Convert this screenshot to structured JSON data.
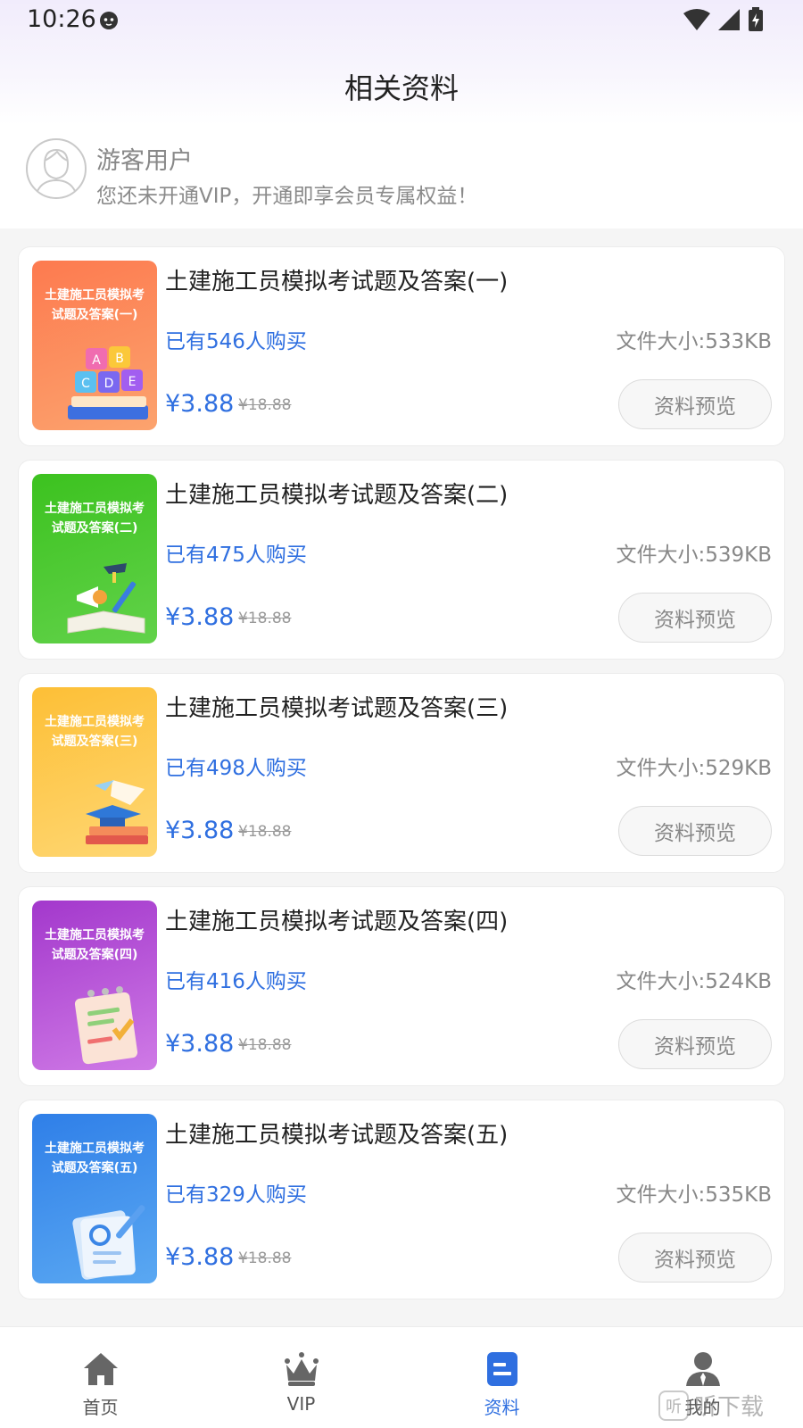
{
  "status_bar": {
    "time": "10:26"
  },
  "header": {
    "title": "相关资料"
  },
  "user": {
    "name": "游客用户",
    "tip": "您还未开通VIP，开通即享会员专属权益！"
  },
  "materials": [
    {
      "cover_line1": "土建施工员模拟考",
      "cover_line2": "试题及答案(一)",
      "title": "土建施工员模拟考试题及答案(一)",
      "buyers": "已有546人购买",
      "file_size": "文件大小:533KB",
      "price": "¥3.88",
      "original_price": "¥18.88",
      "preview_label": "资料预览",
      "cover_color": "#fb8a5a"
    },
    {
      "cover_line1": "土建施工员模拟考",
      "cover_line2": "试题及答案(二)",
      "title": "土建施工员模拟考试题及答案(二)",
      "buyers": "已有475人购买",
      "file_size": "文件大小:539KB",
      "price": "¥3.88",
      "original_price": "¥18.88",
      "preview_label": "资料预览",
      "cover_color": "#49c12c"
    },
    {
      "cover_line1": "土建施工员模拟考",
      "cover_line2": "试题及答案(三)",
      "title": "土建施工员模拟考试题及答案(三)",
      "buyers": "已有498人购买",
      "file_size": "文件大小:529KB",
      "price": "¥3.88",
      "original_price": "¥18.88",
      "preview_label": "资料预览",
      "cover_color": "#fdc94a"
    },
    {
      "cover_line1": "土建施工员模拟考",
      "cover_line2": "试题及答案(四)",
      "title": "土建施工员模拟考试题及答案(四)",
      "buyers": "已有416人购买",
      "file_size": "文件大小:524KB",
      "price": "¥3.88",
      "original_price": "¥18.88",
      "preview_label": "资料预览",
      "cover_color": "#b44fd6"
    },
    {
      "cover_line1": "土建施工员模拟考",
      "cover_line2": "试题及答案(五)",
      "title": "土建施工员模拟考试题及答案(五)",
      "buyers": "已有329人购买",
      "file_size": "文件大小:535KB",
      "price": "¥3.88",
      "original_price": "¥18.88",
      "preview_label": "资料预览",
      "cover_color": "#3f8ff0"
    }
  ],
  "tabbar": {
    "items": [
      {
        "label": "首页",
        "icon": "home-icon"
      },
      {
        "label": "VIP",
        "icon": "crown-icon"
      },
      {
        "label": "资料",
        "icon": "document-icon"
      },
      {
        "label": "我的",
        "icon": "person-icon"
      }
    ],
    "active": "资料"
  },
  "watermark": {
    "text": "听下载",
    "icon_text": "听"
  },
  "colors": {
    "accent": "#2f6fe0",
    "background": "#f5f5f5"
  }
}
